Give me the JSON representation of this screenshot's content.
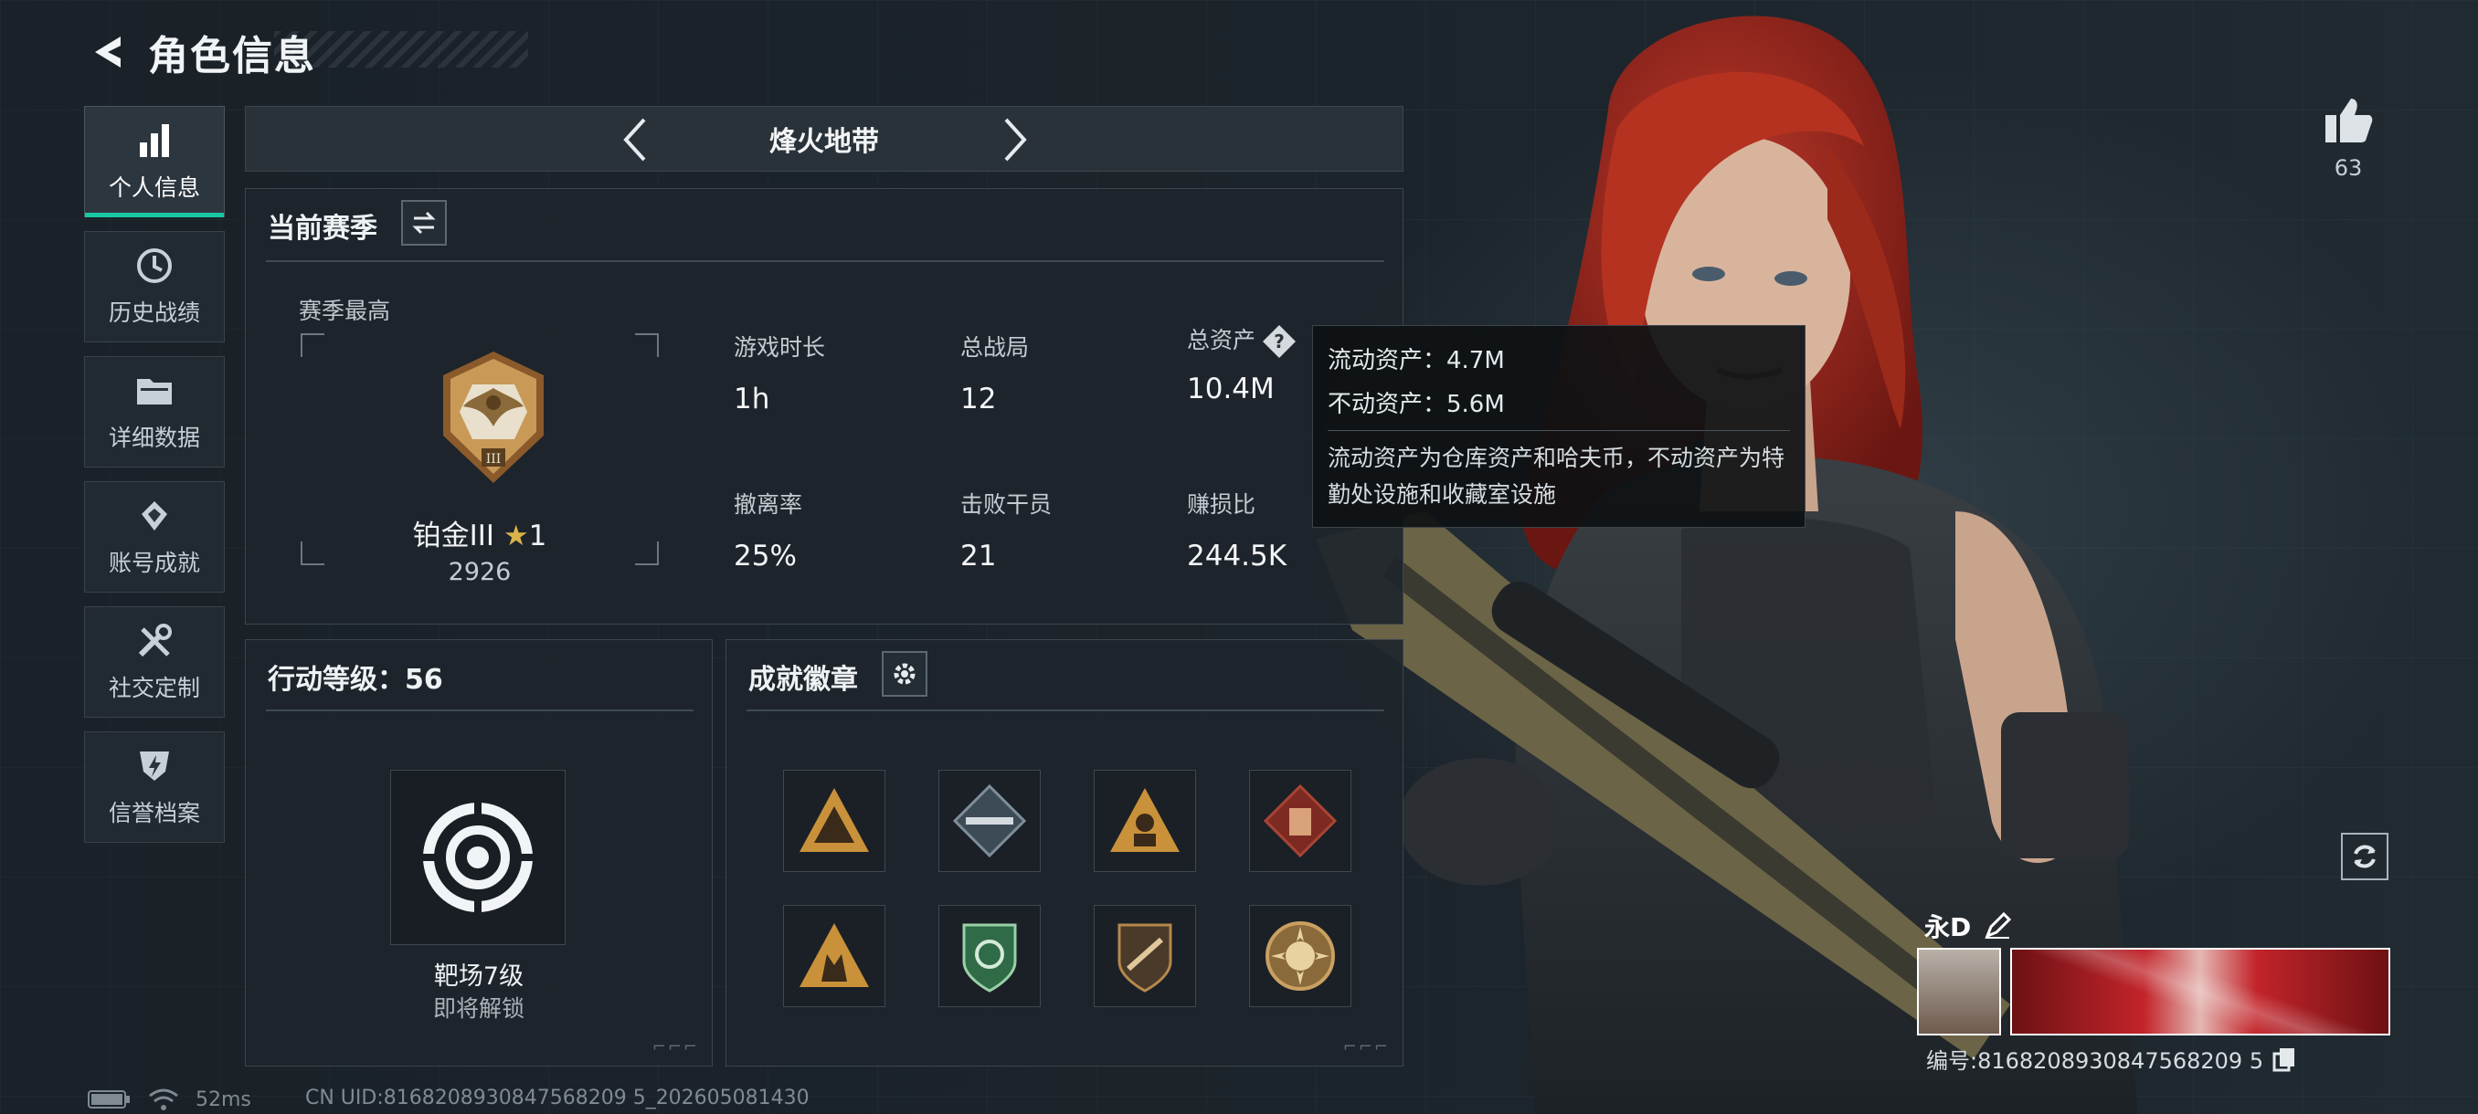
{
  "header": {
    "title": "角色信息"
  },
  "sidebar": {
    "items": [
      {
        "label": "个人信息",
        "icon": "bar-chart-icon",
        "active": true
      },
      {
        "label": "历史战绩",
        "icon": "clock-history-icon",
        "active": false
      },
      {
        "label": "详细数据",
        "icon": "folder-icon",
        "active": false
      },
      {
        "label": "账号成就",
        "icon": "diamond-medal-icon",
        "active": false
      },
      {
        "label": "社交定制",
        "icon": "tools-icon",
        "active": false
      },
      {
        "label": "信誉档案",
        "icon": "shield-lightning-icon",
        "active": false
      }
    ]
  },
  "mode": {
    "title": "烽火地带"
  },
  "season": {
    "heading": "当前赛季",
    "best_label": "赛季最高",
    "rank_name": "铂金III",
    "rank_stars": "1",
    "rank_score": "2926",
    "stats": [
      {
        "label": "游戏时长",
        "value": "1h"
      },
      {
        "label": "总战局",
        "value": "12"
      },
      {
        "label": "总资产",
        "value": "10.4M"
      },
      {
        "label": "撤离率",
        "value": "25%"
      },
      {
        "label": "击败干员",
        "value": "21"
      },
      {
        "label": "赚损比",
        "value": "244.5K"
      }
    ]
  },
  "tooltip": {
    "liquid": "流动资产：4.7M",
    "fixed": "不动资产：5.6M",
    "description": "流动资产为仓库资产和哈夫币，不动资产为特勤处设施和收藏室设施"
  },
  "level": {
    "heading": "行动等级：56",
    "name": "靶场7级",
    "status": "即将解锁"
  },
  "achievements": {
    "heading": "成就徽章",
    "badges": [
      {
        "icon": "mountain-badge-icon",
        "color": "#c9913a"
      },
      {
        "icon": "rifle-badge-icon",
        "color": "#7d8d9a"
      },
      {
        "icon": "soldier-badge-icon",
        "color": "#c9913a"
      },
      {
        "icon": "vest-badge-icon",
        "color": "#a84535"
      },
      {
        "icon": "squad-badge-icon",
        "color": "#c9913a"
      },
      {
        "icon": "wreath-shield-badge-icon",
        "color": "#3f8a5a"
      },
      {
        "icon": "weapon-shield-badge-icon",
        "color": "#b5884a"
      },
      {
        "icon": "sun-medal-badge-icon",
        "color": "#c9a060"
      }
    ]
  },
  "profile": {
    "likes": "63",
    "name": "永D",
    "id_text": "编号:8168208930847568209 5"
  },
  "status_bar": {
    "ping": "52ms",
    "uid": "CN UID:8168208930847568209 5_202605081430"
  },
  "colors": {
    "accent": "#18c7a4",
    "panel": "#1e252b",
    "tooltip": "#0e1114"
  }
}
